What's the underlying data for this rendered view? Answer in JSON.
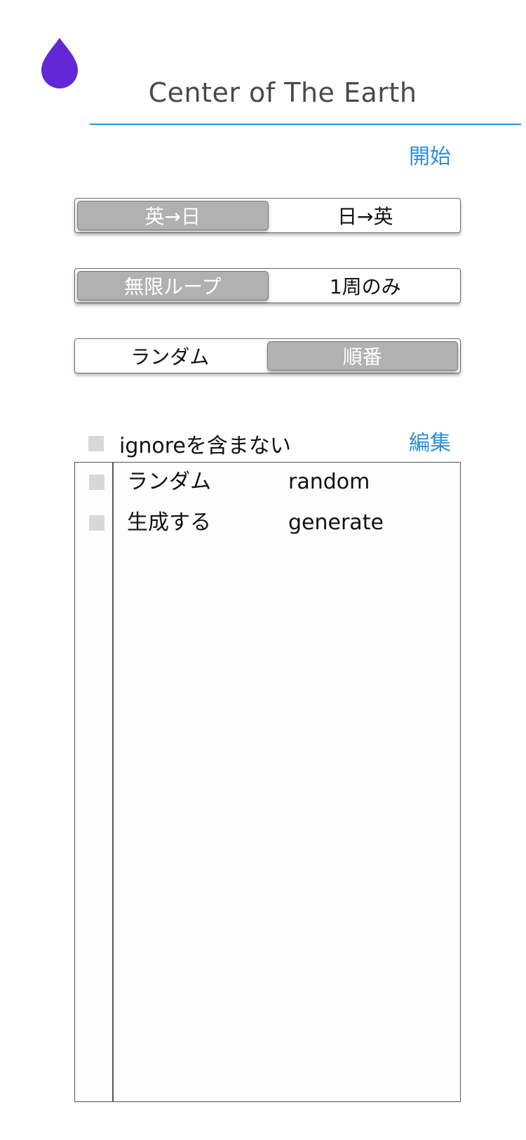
{
  "header": {
    "logo_icon": "drop-icon",
    "logo_color": "#6327d8",
    "title": "Center of The Earth",
    "start_label": "開始"
  },
  "direction_toggle": {
    "options": [
      "英→日",
      "日→英"
    ],
    "selected": "英→日"
  },
  "loop_toggle": {
    "options": [
      "無限ループ",
      "1周のみ"
    ],
    "selected": "無限ループ"
  },
  "order_toggle": {
    "options": [
      "ランダム",
      "順番"
    ],
    "selected": "順番"
  },
  "filter": {
    "ignore_label": "ignoreを含まない",
    "edit_label": "編集"
  },
  "word_list": [
    {
      "jp": "ランダム",
      "en": "random"
    },
    {
      "jp": "生成する",
      "en": "generate"
    }
  ],
  "colors": {
    "accent": "#2f8fd6",
    "underline": "#2196e0",
    "selected_segment": "#b1b1b1",
    "checkbox": "#d8d8d8"
  }
}
